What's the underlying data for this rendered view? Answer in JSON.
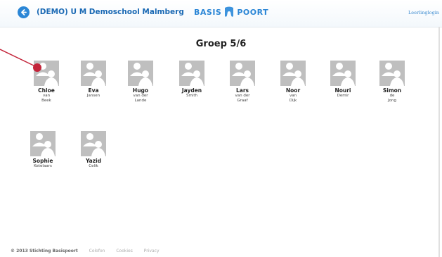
{
  "header": {
    "school_name": "(DEMO) U M Demoschool Malmberg",
    "logo_left": "BASIS",
    "logo_right": "POORT",
    "logout_label": "Leerlinglogin"
  },
  "group_title": "Groep 5/6",
  "pupils": [
    {
      "first": "Chloe",
      "last": "van\nBeek"
    },
    {
      "first": "Eva",
      "last": "Jansen"
    },
    {
      "first": "Hugo",
      "last": "van der\nLande"
    },
    {
      "first": "Jayden",
      "last": "Smith"
    },
    {
      "first": "Lars",
      "last": "van der\nGraaf"
    },
    {
      "first": "Noor",
      "last": "van\nDijk"
    },
    {
      "first": "Nouri",
      "last": "Demir"
    },
    {
      "first": "Simon",
      "last": "de\nJong"
    },
    {
      "first": "Sophie",
      "last": "Ketelaars"
    },
    {
      "first": "Yazid",
      "last": "Celik"
    }
  ],
  "footer": {
    "copyright": "© 2013 Stichting Basispoort",
    "links": [
      "Colofon",
      "Cookies",
      "Privacy"
    ]
  },
  "colors": {
    "accent": "#2b86d6",
    "pointer": "#c3243a"
  }
}
